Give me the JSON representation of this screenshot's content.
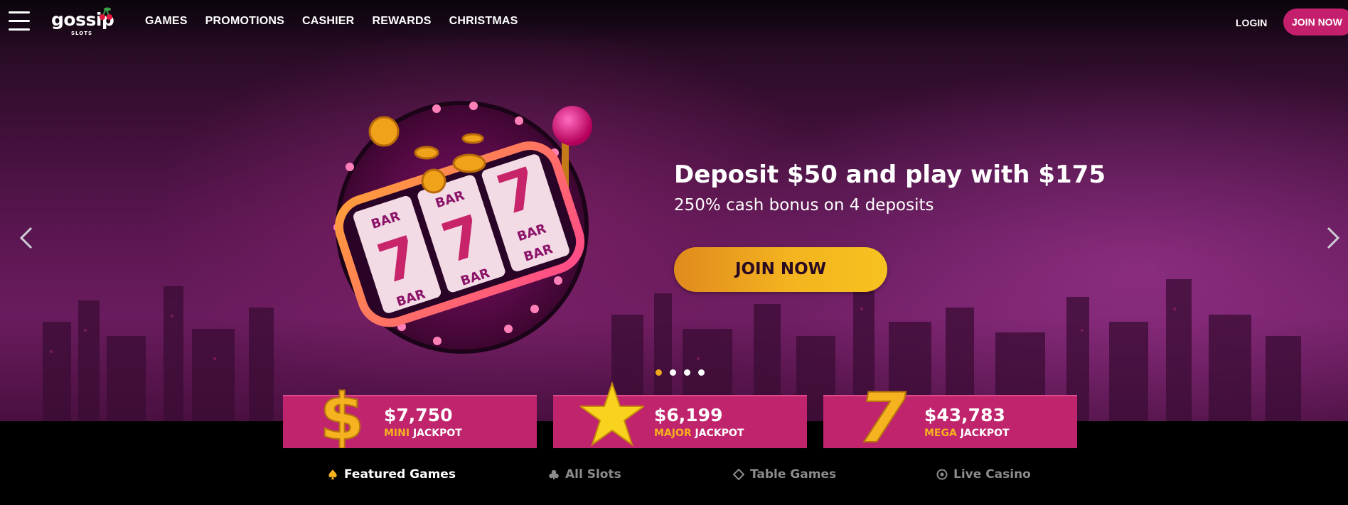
{
  "brand": {
    "name": "gossip",
    "tagline": "SLOTS"
  },
  "nav": {
    "items": [
      {
        "label": "GAMES"
      },
      {
        "label": "PROMOTIONS"
      },
      {
        "label": "CASHIER"
      },
      {
        "label": "REWARDS"
      },
      {
        "label": "CHRISTMAS"
      }
    ],
    "login_label": "LOGIN",
    "join_label": "JOIN NOW"
  },
  "hero": {
    "headline": "Deposit $50 and play with $175",
    "subline": "250% cash bonus on 4 deposits",
    "cta_label": "JOIN NOW",
    "slot_graphic": {
      "reel_symbols": [
        "BAR",
        "7",
        "BAR"
      ]
    },
    "carousel": {
      "slide_count": 4,
      "active_index": 0
    }
  },
  "jackpots": [
    {
      "icon": "dollar-sign-icon",
      "amount": "$7,750",
      "tier": "MINI",
      "word": "JACKPOT"
    },
    {
      "icon": "star-icon",
      "amount": "$6,199",
      "tier": "MAJOR",
      "word": "JACKPOT"
    },
    {
      "icon": "seven-icon",
      "amount": "$43,783",
      "tier": "MEGA",
      "word": "JACKPOT"
    }
  ],
  "game_tabs": [
    {
      "label": "Featured Games",
      "icon": "spade-icon",
      "active": true
    },
    {
      "label": "All Slots",
      "icon": "club-icon",
      "active": false
    },
    {
      "label": "Table Games",
      "icon": "diamond-icon",
      "active": false
    },
    {
      "label": "Live Casino",
      "icon": "poker-chip-icon",
      "active": false
    }
  ],
  "colors": {
    "accent_pink": "#c41f6c",
    "jackpot_bg": "#c0246c",
    "cta_gold": "#f4b41f",
    "tier_gold": "#f6b21f",
    "active_dot": "#f0a81e"
  }
}
